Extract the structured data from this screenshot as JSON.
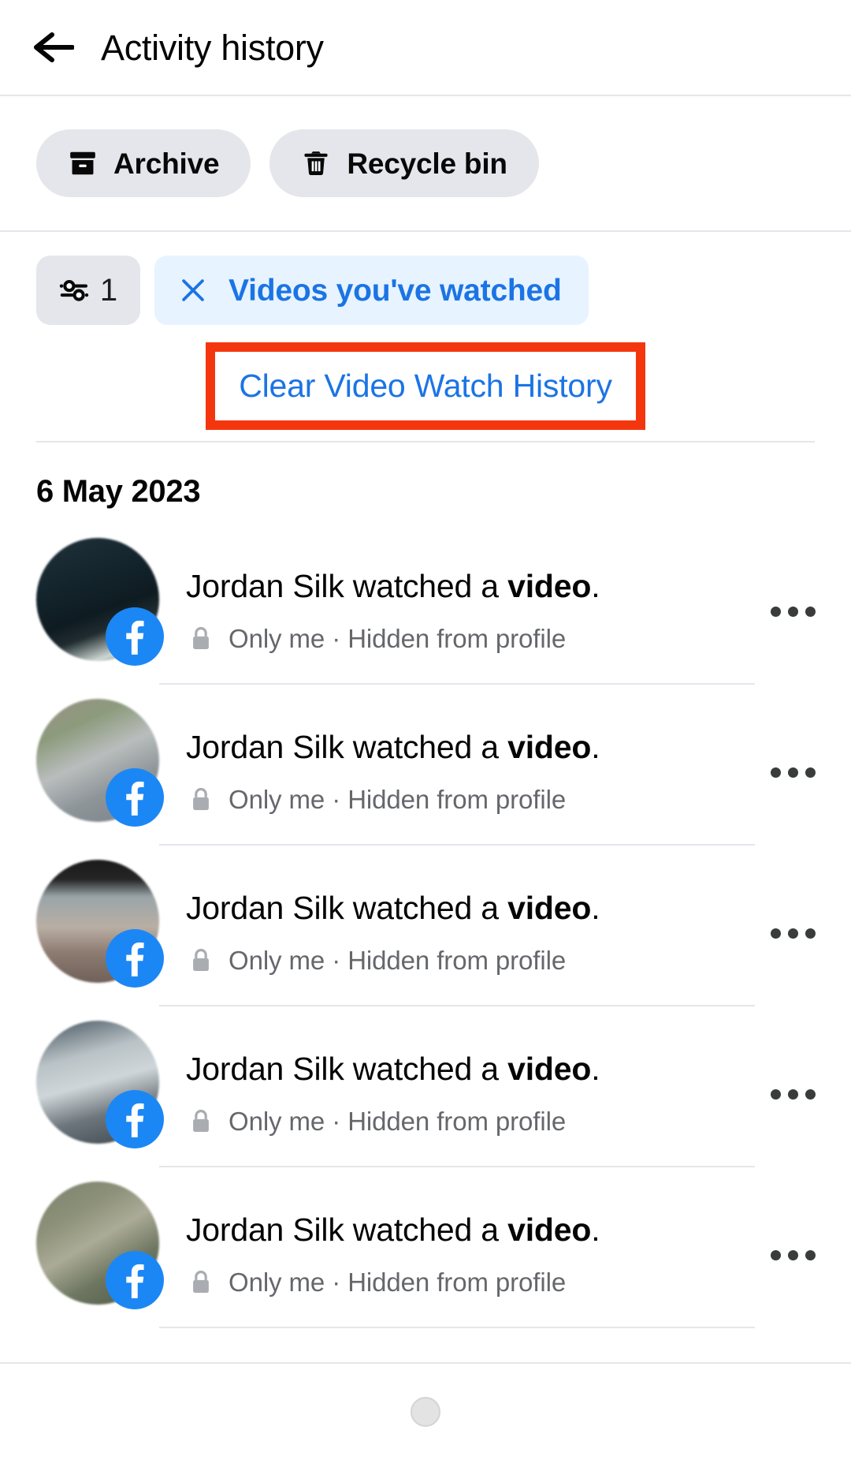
{
  "header": {
    "title": "Activity history",
    "back_icon": "arrow-left-icon"
  },
  "shortcuts": [
    {
      "label": "Archive",
      "icon": "archive-box-icon"
    },
    {
      "label": "Recycle bin",
      "icon": "trash-icon"
    }
  ],
  "filters": {
    "count": "1",
    "count_icon": "sliders-icon",
    "active_filter": {
      "label": "Videos you've watched",
      "remove_icon": "close-x-icon"
    }
  },
  "clear_action": {
    "label": "Clear Video Watch History",
    "highlight_color": "#f4360f"
  },
  "colors": {
    "accent_blue": "#1b74e4",
    "chip_gray": "#e4e6eb",
    "pill_blue_bg": "#e7f3ff",
    "facebook_blue": "#1b87f5",
    "secondary_text": "#65676b"
  },
  "sections": [
    {
      "date": "6 May 2023",
      "items": [
        {
          "title_prefix": "Jordan Silk watched a ",
          "title_bold": "video",
          "title_suffix": ".",
          "privacy_icon": "lock-icon",
          "meta": "Only me · Hidden from profile",
          "platform_badge": "facebook-icon",
          "menu_icon": "more-options-icon",
          "thumb_css": "linear-gradient(160deg,#20313a 0%,#14242c 35%,#0e1b21 58%,#202c30 70%,#cfd8d4 86%,#23312f 100%)"
        },
        {
          "title_prefix": "Jordan Silk watched a ",
          "title_bold": "video",
          "title_suffix": ".",
          "privacy_icon": "lock-icon",
          "meta": "Only me · Hidden from profile",
          "platform_badge": "facebook-icon",
          "menu_icon": "more-options-icon",
          "thumb_css": "linear-gradient(155deg,#9a8f87 0%,#8c9b7c 25%,#b9bdbd 48%,#8e9599 70%,#7a8087 100%)"
        },
        {
          "title_prefix": "Jordan Silk watched a ",
          "title_bold": "video",
          "title_suffix": ".",
          "privacy_icon": "lock-icon",
          "meta": "Only me · Hidden from profile",
          "platform_badge": "facebook-icon",
          "menu_icon": "more-options-icon",
          "thumb_css": "linear-gradient(180deg,#1a1a1a 0%,#252525 16%,#9aa5a8 30%,#b9aea4 55%,#8e7c72 75%,#6f6059 100%)"
        },
        {
          "title_prefix": "Jordan Silk watched a ",
          "title_bold": "video",
          "title_suffix": ".",
          "privacy_icon": "lock-icon",
          "meta": "Only me · Hidden from profile",
          "platform_badge": "facebook-icon",
          "menu_icon": "more-options-icon",
          "thumb_css": "linear-gradient(165deg,#42525c 0%,#b9c2c6 30%,#cfd6d9 50%,#6d767c 72%,#3c464c 100%)"
        },
        {
          "title_prefix": "Jordan Silk watched a ",
          "title_bold": "video",
          "title_suffix": ".",
          "privacy_icon": "lock-icon",
          "meta": "Only me · Hidden from profile",
          "platform_badge": "facebook-icon",
          "menu_icon": "more-options-icon",
          "thumb_css": "linear-gradient(150deg,#79806c 0%,#8d9179 28%,#abab97 48%,#6d7660 70%,#4f5748 100%)"
        }
      ]
    }
  ],
  "bottom_bar": {
    "home_indicator": "home-button-icon"
  }
}
